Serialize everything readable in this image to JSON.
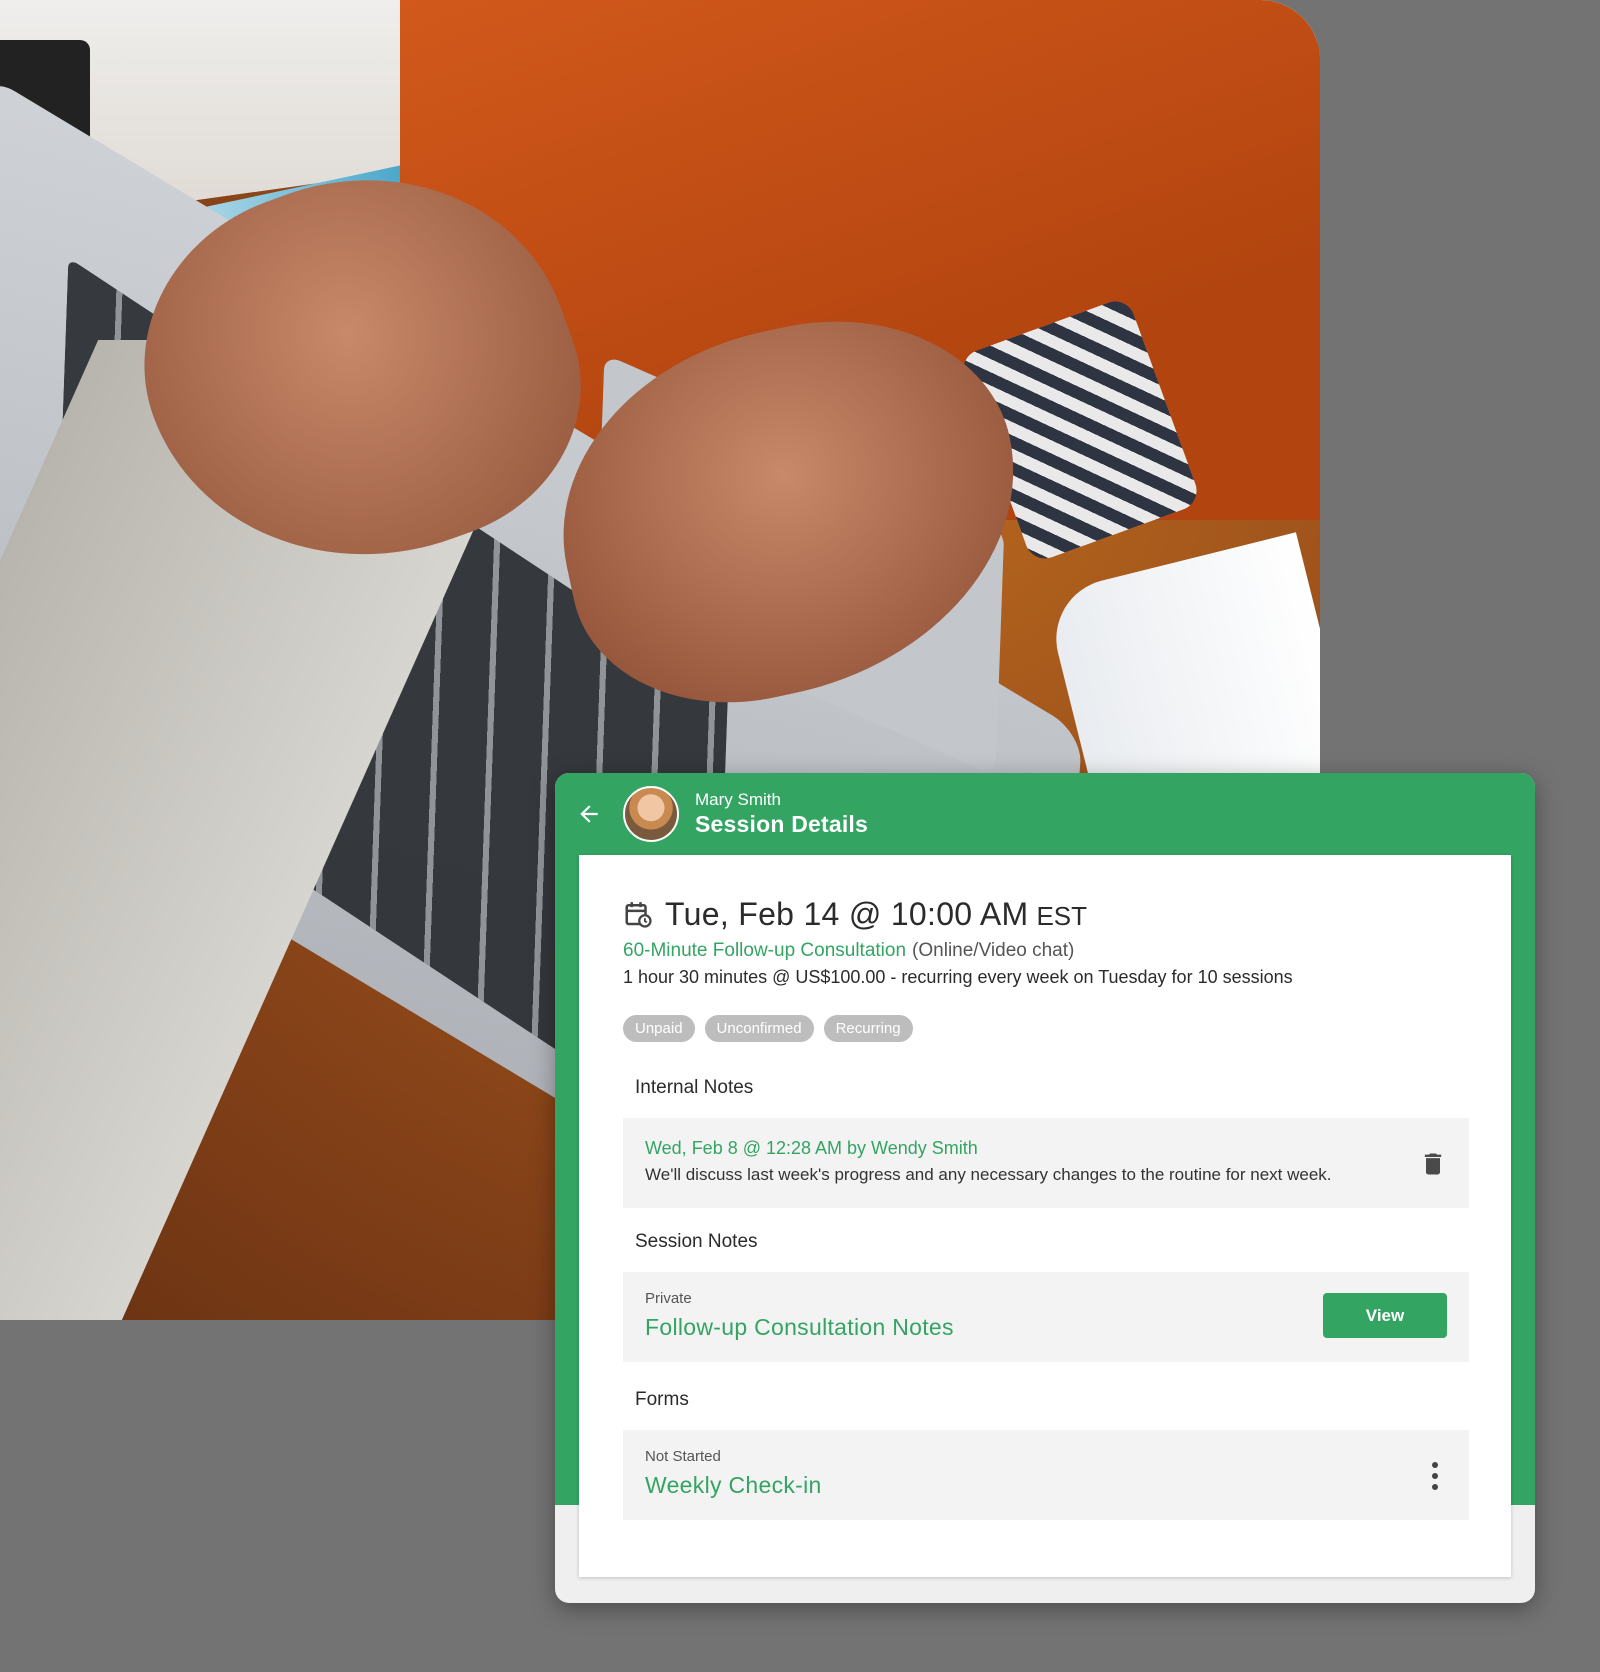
{
  "header": {
    "client_name": "Mary Smith",
    "title": "Session Details",
    "back_icon": "arrow-left-icon"
  },
  "session": {
    "date_time": "Tue, Feb 14 @ 10:00 AM",
    "timezone": "EST",
    "service_name": "60-Minute Follow-up Consultation",
    "service_mode": "(Online/Video chat)",
    "detail": "1 hour 30 minutes @ US$100.00 - recurring every week on Tuesday for 10 sessions",
    "chips": [
      "Unpaid",
      "Unconfirmed",
      "Recurring"
    ]
  },
  "internal_notes": {
    "title": "Internal Notes",
    "note_meta": "Wed, Feb 8 @ 12:28 AM by Wendy Smith",
    "note_body": "We'll discuss last week's progress and any necessary changes to the routine for next week."
  },
  "session_notes": {
    "title": "Session Notes",
    "visibility": "Private",
    "note_title": "Follow-up Consultation Notes",
    "view_label": "View"
  },
  "forms": {
    "title": "Forms",
    "status": "Not Started",
    "form_title": "Weekly Check-in"
  },
  "colors": {
    "brand_green": "#34a463",
    "chip_gray": "#bdbdbd",
    "row_bg": "#f3f3f3"
  }
}
